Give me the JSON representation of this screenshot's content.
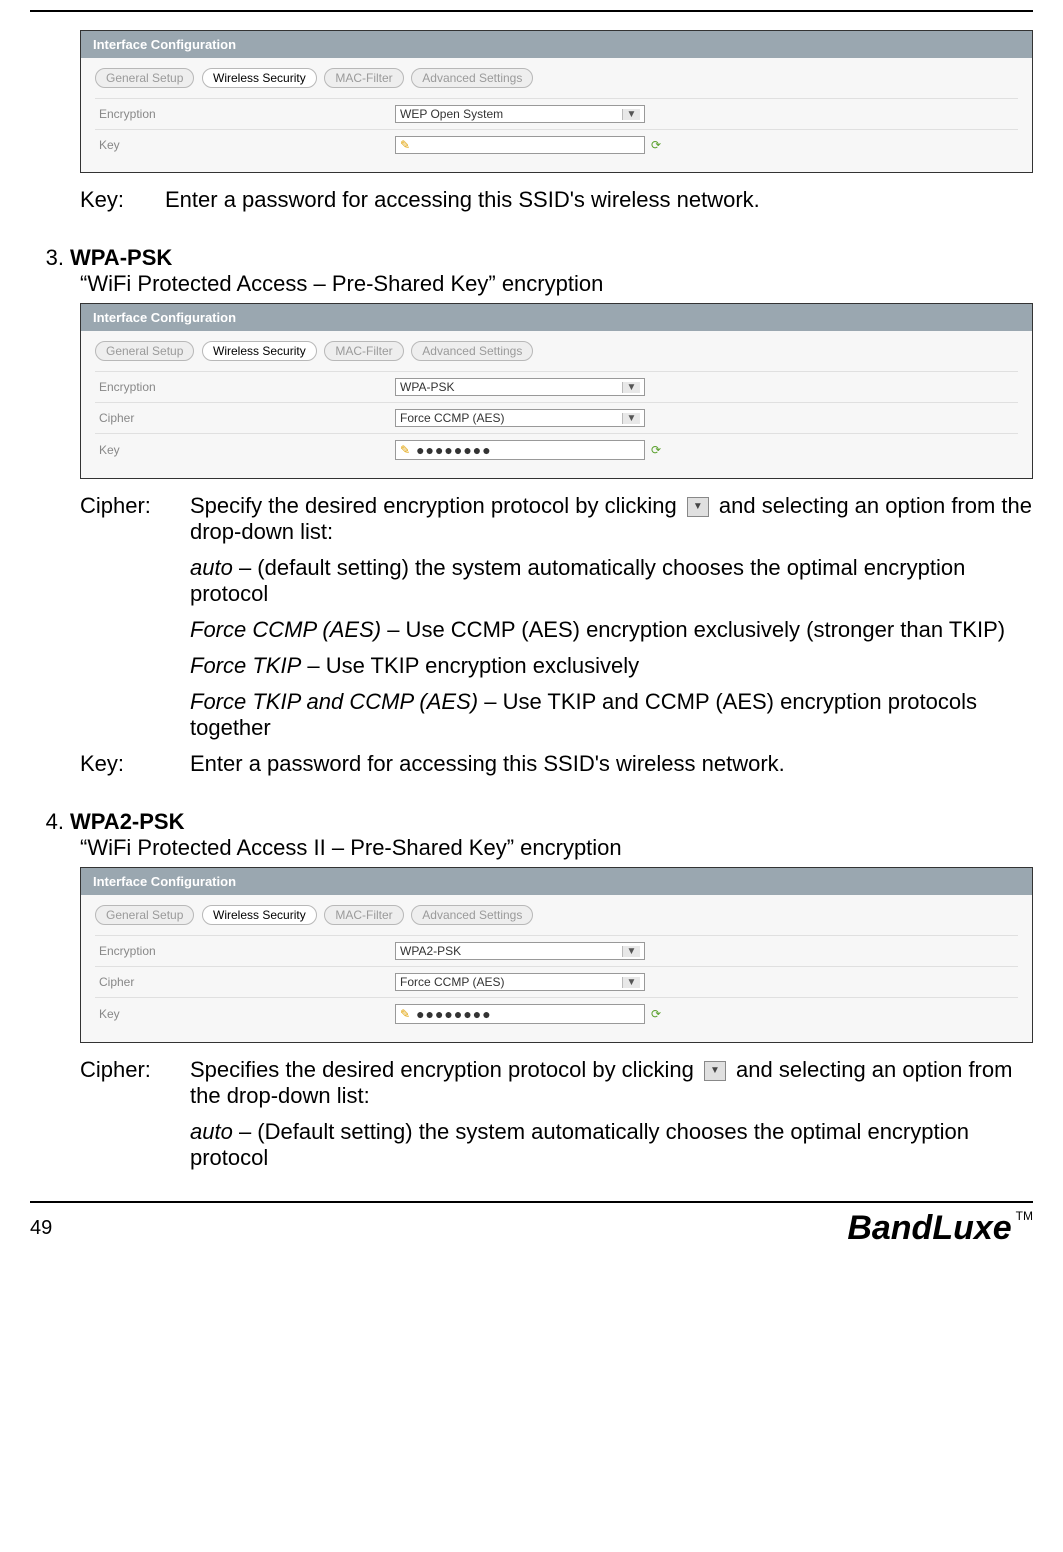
{
  "panel1": {
    "title": "Interface Configuration",
    "tabs": [
      "General Setup",
      "Wireless Security",
      "MAC-Filter",
      "Advanced Settings"
    ],
    "active_tab_index": 1,
    "rows": {
      "encryption": {
        "label": "Encryption",
        "value": "WEP Open System"
      },
      "key": {
        "label": "Key",
        "value": ""
      }
    }
  },
  "key_line_1": {
    "label": "Key:",
    "text": "Enter a password for accessing this SSID's wireless network."
  },
  "section_wpa": {
    "num": "3.",
    "title": "WPA-PSK",
    "subtitle": "“WiFi Protected Access – Pre-Shared Key” encryption"
  },
  "panel2": {
    "title": "Interface Configuration",
    "tabs": [
      "General Setup",
      "Wireless Security",
      "MAC-Filter",
      "Advanced Settings"
    ],
    "active_tab_index": 1,
    "rows": {
      "encryption": {
        "label": "Encryption",
        "value": "WPA-PSK"
      },
      "cipher": {
        "label": "Cipher",
        "value": "Force CCMP (AES)"
      },
      "key": {
        "label": "Key",
        "value": "●●●●●●●●"
      }
    }
  },
  "wpa_cipher": {
    "label": "Cipher:",
    "intro_a": "Specify the desired encryption protocol by clicking ",
    "intro_b": " and selecting an option from the drop-down list:",
    "options": [
      {
        "name": "auto",
        "desc": " – (default setting) the system automatically chooses the optimal encryption protocol"
      },
      {
        "name": "Force CCMP (AES)",
        "desc": " – Use CCMP (AES) encryption exclusively (stronger than TKIP)"
      },
      {
        "name": "Force TKIP",
        "desc": " – Use TKIP encryption exclusively"
      },
      {
        "name": "Force TKIP and CCMP (AES)",
        "desc": " – Use TKIP and CCMP (AES) encryption protocols together"
      }
    ]
  },
  "wpa_key": {
    "label": "Key:",
    "text": "Enter a password for accessing this SSID's wireless network."
  },
  "section_wpa2": {
    "num": "4.",
    "title": "WPA2-PSK",
    "subtitle": "“WiFi Protected Access II – Pre-Shared Key” encryption"
  },
  "panel3": {
    "title": "Interface Configuration",
    "tabs": [
      "General Setup",
      "Wireless Security",
      "MAC-Filter",
      "Advanced Settings"
    ],
    "active_tab_index": 1,
    "rows": {
      "encryption": {
        "label": "Encryption",
        "value": "WPA2-PSK"
      },
      "cipher": {
        "label": "Cipher",
        "value": "Force CCMP (AES)"
      },
      "key": {
        "label": "Key",
        "value": "●●●●●●●●"
      }
    }
  },
  "wpa2_cipher": {
    "label": "Cipher:",
    "intro_a": "Specifies the desired encryption protocol by clicking ",
    "intro_b": " and selecting an option from the drop-down list:",
    "options": [
      {
        "name": "auto",
        "desc": " – (Default setting) the system automatically chooses the optimal encryption protocol"
      }
    ]
  },
  "footer": {
    "page": "49",
    "brand": "BandLuxe",
    "tm": "TM"
  }
}
